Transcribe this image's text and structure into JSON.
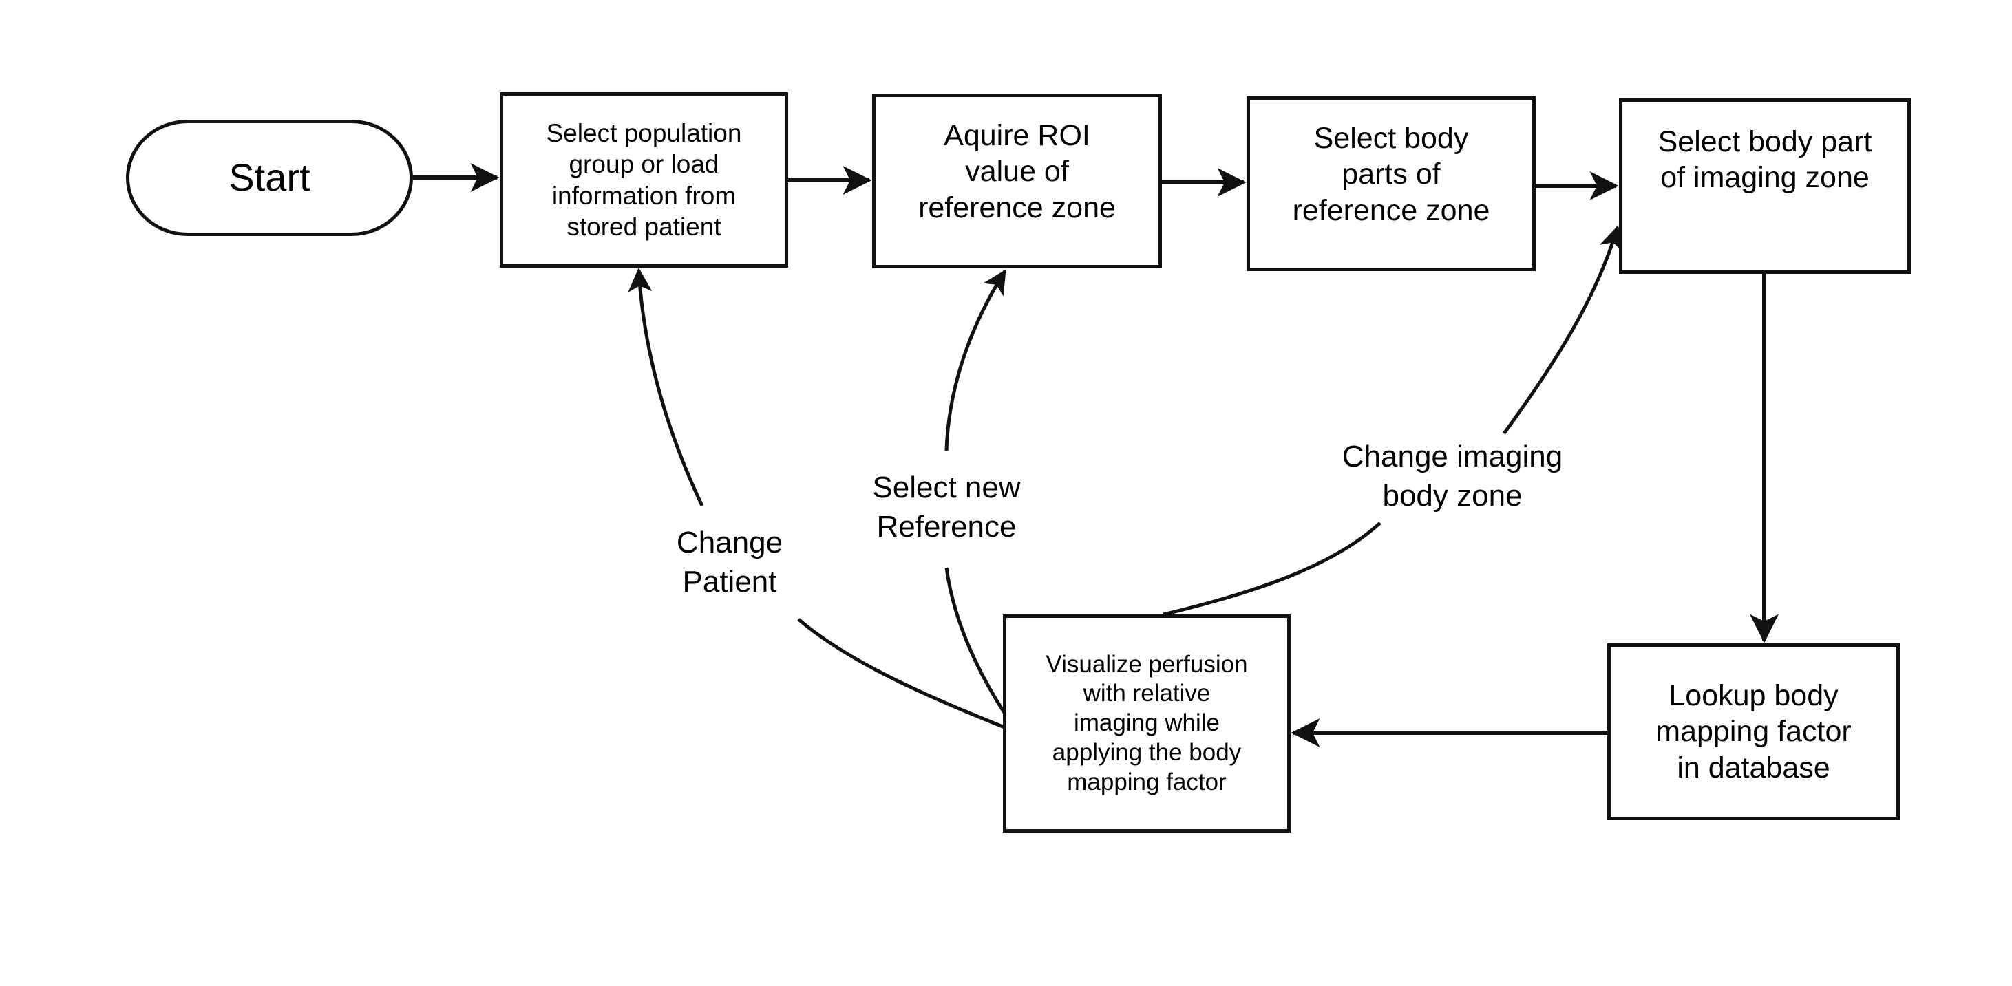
{
  "diagram": {
    "type": "flowchart",
    "nodes": [
      {
        "id": "start",
        "shape": "terminal",
        "text": "Start"
      },
      {
        "id": "select-population",
        "shape": "process",
        "text": "Select population\ngroup or load\ninformation from\nstored patient"
      },
      {
        "id": "acquire-roi",
        "shape": "process",
        "text": "Aquire ROI\nvalue of\nreference zone"
      },
      {
        "id": "select-body-parts-reference",
        "shape": "process",
        "text": "Select body\nparts of\nreference zone"
      },
      {
        "id": "select-body-part-imaging",
        "shape": "process",
        "text": "Select body part\nof imaging zone"
      },
      {
        "id": "lookup-mapping-factor",
        "shape": "process",
        "text": "Lookup body\nmapping factor\nin database"
      },
      {
        "id": "visualize-perfusion",
        "shape": "process",
        "text": "Visualize perfusion\nwith relative\nimaging while\napplying the body\nmapping factor"
      }
    ],
    "edges": [
      {
        "from": "start",
        "to": "select-population",
        "label": ""
      },
      {
        "from": "select-population",
        "to": "acquire-roi",
        "label": ""
      },
      {
        "from": "acquire-roi",
        "to": "select-body-parts-reference",
        "label": ""
      },
      {
        "from": "select-body-parts-reference",
        "to": "select-body-part-imaging",
        "label": ""
      },
      {
        "from": "select-body-part-imaging",
        "to": "lookup-mapping-factor",
        "label": ""
      },
      {
        "from": "lookup-mapping-factor",
        "to": "visualize-perfusion",
        "label": ""
      },
      {
        "from": "visualize-perfusion",
        "to": "select-population",
        "label": "Change\nPatient"
      },
      {
        "from": "visualize-perfusion",
        "to": "acquire-roi",
        "label": "Select new\nReference"
      },
      {
        "from": "visualize-perfusion",
        "to": "select-body-part-imaging",
        "label": "Change imaging\nbody zone"
      }
    ]
  },
  "colors": {
    "stroke": "#111111",
    "background": "#ffffff"
  }
}
